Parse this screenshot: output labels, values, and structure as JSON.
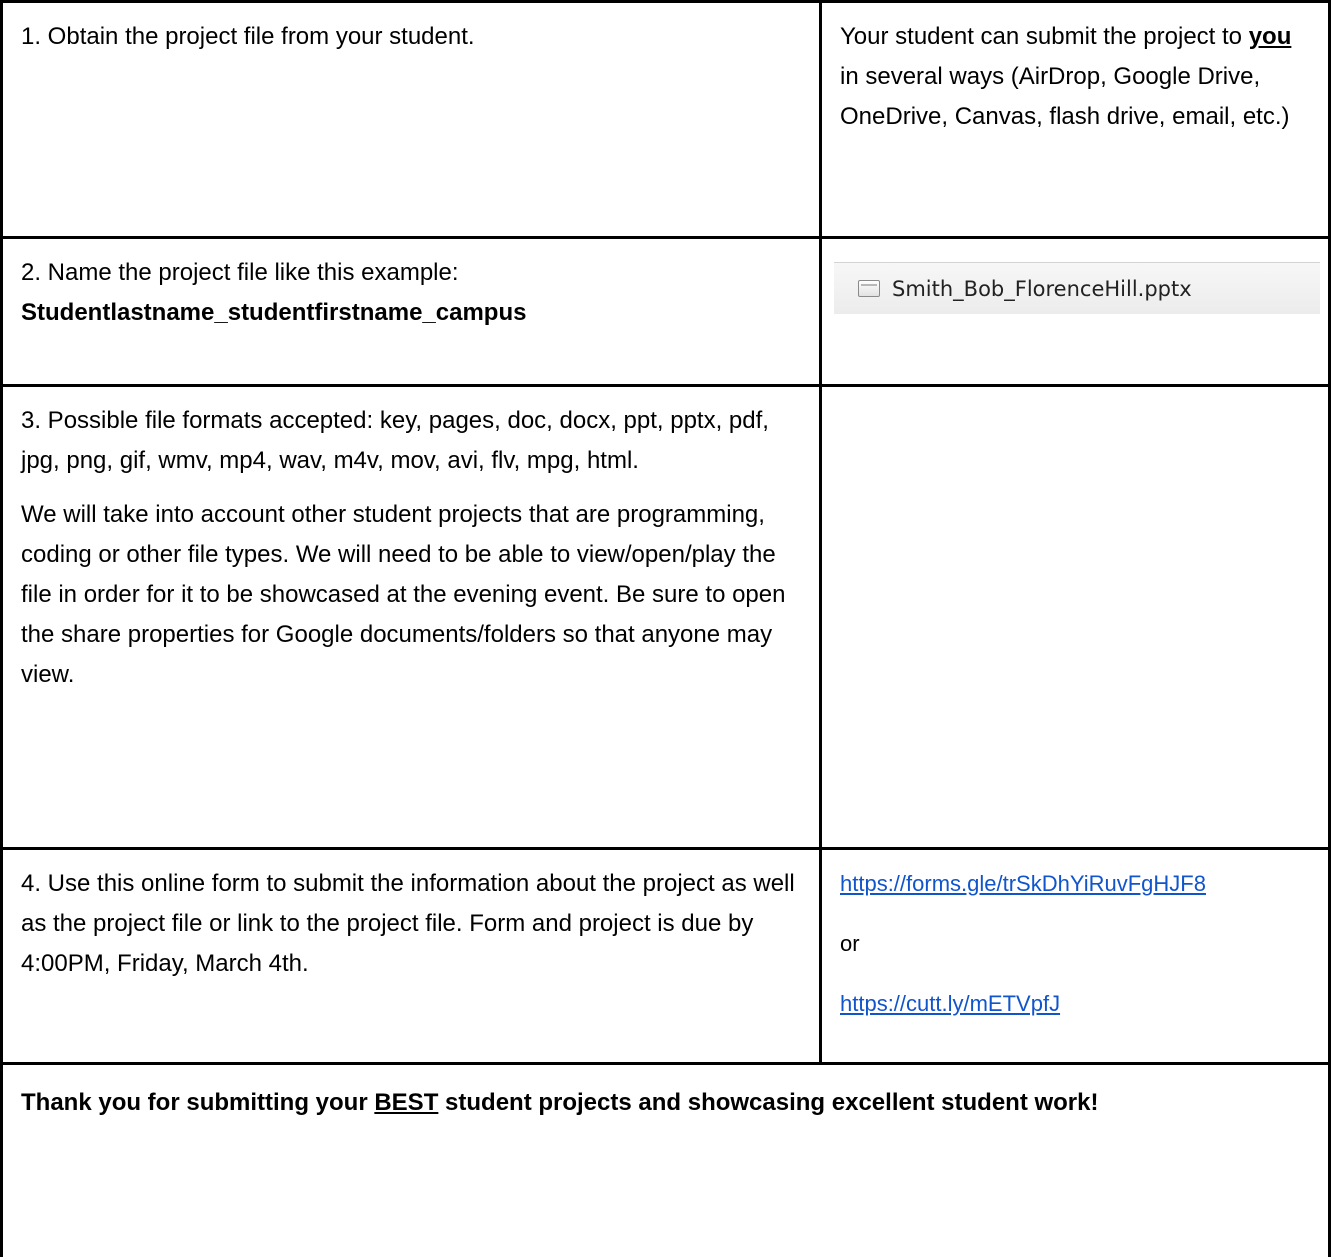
{
  "rows": [
    {
      "left": "1. Obtain the project file from your student.",
      "right": {
        "before": "Your student can submit the project to ",
        "emph": "you",
        "after": " in several ways (AirDrop, Google Drive, OneDrive, Canvas, flash drive, email, etc.)"
      }
    },
    {
      "left_line1": "2. Name the project file like this example:",
      "left_line2": "Studentlastname_studentfirstname_campus",
      "right": {
        "file_icon": "document-icon",
        "filename": "Smith_Bob_FlorenceHill.pptx"
      }
    },
    {
      "left_para1": "3. Possible file formats accepted: key, pages, doc, docx, ppt, pptx, pdf, jpg, png, gif, wmv, mp4, wav, m4v, mov, avi, flv, mpg, html.",
      "left_para2": "We will take into account other student projects that are programming, coding or other file types. We will need to be able to view/open/play the file in order for it to be showcased at the evening event. Be sure to open the share properties for Google documents/folders so that anyone may view.",
      "right": ""
    },
    {
      "left": "4. Use this online form to submit the information about the project as well as the project file or link to the project file. Form and project is due by 4:00PM, Friday, March 4th.",
      "right": {
        "link1": "https://forms.gle/trSkDhYiRuvFgHJF8",
        "or": "or",
        "link2": "https://cutt.ly/mETVpfJ"
      }
    }
  ],
  "footer": {
    "before": "Thank you for submitting your ",
    "emph": "BEST",
    "after": " student projects and showcasing excellent student work!"
  },
  "colors": {
    "border": "#000000",
    "link": "#1155cc",
    "text": "#000000"
  }
}
